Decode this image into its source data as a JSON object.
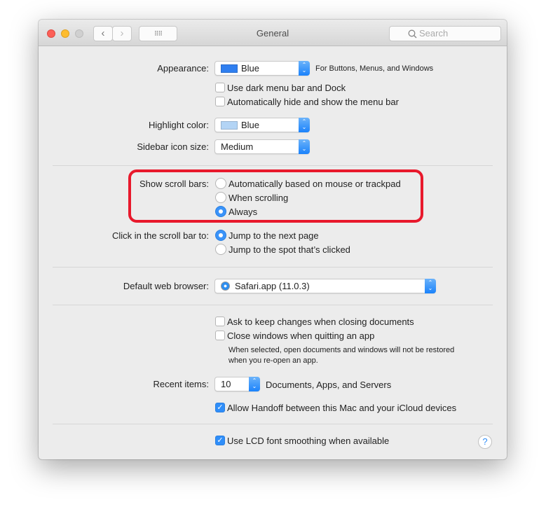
{
  "window": {
    "title": "General",
    "search_placeholder": "Search"
  },
  "appearance": {
    "label": "Appearance:",
    "value": "Blue",
    "swatch_color": "#2f7ff0",
    "note": "For Buttons, Menus, and Windows",
    "dark_menu": {
      "label": "Use dark menu bar and Dock",
      "checked": false
    },
    "auto_hide": {
      "label": "Automatically hide and show the menu bar",
      "checked": false
    }
  },
  "highlight": {
    "label": "Highlight color:",
    "value": "Blue",
    "swatch_color": "#b3d4f5"
  },
  "sidebar_icon": {
    "label": "Sidebar icon size:",
    "value": "Medium"
  },
  "scroll_bars": {
    "label": "Show scroll bars:",
    "options": [
      "Automatically based on mouse or trackpad",
      "When scrolling",
      "Always"
    ],
    "selected": "Always",
    "highlight_color": "#e8192c"
  },
  "scroll_click": {
    "label": "Click in the scroll bar to:",
    "options": [
      "Jump to the next page",
      "Jump to the spot that’s clicked"
    ],
    "selected": "Jump to the next page"
  },
  "browser": {
    "label": "Default web browser:",
    "value": "Safari.app (11.0.3)"
  },
  "ask_keep": {
    "label": "Ask to keep changes when closing documents",
    "checked": false
  },
  "close_windows": {
    "label": "Close windows when quitting an app",
    "checked": false,
    "note_line1": "When selected, open documents and windows will not be restored",
    "note_line2": "when you re-open an app."
  },
  "recent": {
    "label": "Recent items:",
    "value": "10",
    "suffix": "Documents, Apps, and Servers"
  },
  "handoff": {
    "label": "Allow Handoff between this Mac and your iCloud devices",
    "checked": true
  },
  "lcd": {
    "label": "Use LCD font smoothing when available",
    "checked": true
  },
  "help": "?"
}
